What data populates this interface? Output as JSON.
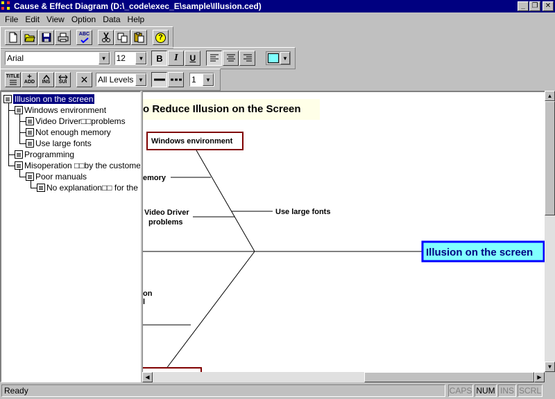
{
  "window": {
    "title": "Cause & Effect Diagram (D:\\_code\\exec_E\\sample\\Illusion.ced)",
    "minimize": "_",
    "restore": "❐",
    "close": "✕"
  },
  "menu": [
    {
      "label": "File",
      "key": "F"
    },
    {
      "label": "Edit",
      "key": "E"
    },
    {
      "label": "View",
      "key": "V"
    },
    {
      "label": "Option",
      "key": "O"
    },
    {
      "label": "Data",
      "key": "D"
    },
    {
      "label": "Help",
      "key": "H"
    }
  ],
  "toolbar": {
    "spell_glyph": "ABC",
    "help_glyph": "?",
    "bold": "B",
    "italic": "I",
    "underline": "U",
    "title_label": "TITLE",
    "add_label": "ADD",
    "ins_label": "INS",
    "sui_label": "SUI",
    "delete_glyph": "✕",
    "dropdown_arrow": "▼"
  },
  "format": {
    "font_name": "Arial",
    "font_size": "12",
    "levels": "All Levels",
    "line_width": "1",
    "color_swatch": "#80ffff"
  },
  "tree": {
    "nodes": [
      "Illusion on the screen",
      "Windows environment",
      "Video Driver□□problems",
      "Not enough memory",
      "Use large fonts",
      "Programming",
      "Misoperation □□by the customer",
      "Poor manuals",
      "No explanation□□ for the"
    ]
  },
  "diagram": {
    "title": "o Reduce Illusion on the Screen",
    "effect": "Illusion on the screen",
    "category_top": "Windows environment",
    "cause_memory": "emory",
    "cause_video_1": "Video Driver",
    "cause_video_2": "problems",
    "cause_fonts": "Use large fonts",
    "partial_1": "on",
    "partial_2": "l",
    "colors": {
      "effect_border": "#0000ff",
      "effect_fill": "#80ffff",
      "category_border": "#800000"
    }
  },
  "status": {
    "text": "Ready",
    "caps": "CAPS",
    "num": "NUM",
    "ins": "INS",
    "scrl": "SCRL"
  }
}
